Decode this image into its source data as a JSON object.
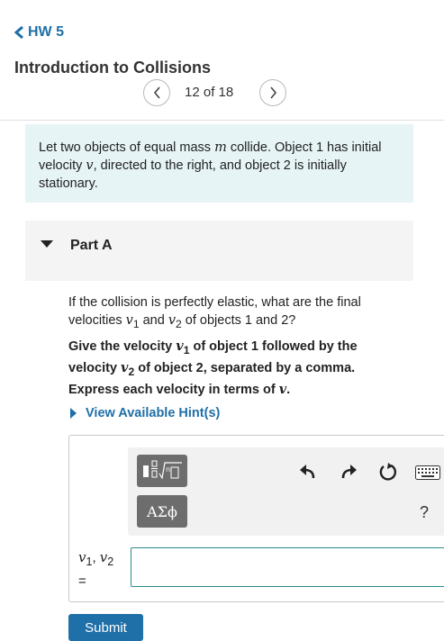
{
  "nav": {
    "back_label": "HW 5"
  },
  "header": {
    "title": "Introduction to Collisions",
    "counter": "12 of 18"
  },
  "intro": {
    "segments": [
      "Let two objects of equal mass ",
      "m",
      " collide. Object 1 has initial velocity ",
      "v",
      ", directed to the right, and object 2 is initially stationary."
    ]
  },
  "part": {
    "title": "Part A"
  },
  "question": {
    "segments": [
      "If the collision is perfectly elastic, what are the final velocities ",
      "v",
      "1",
      " and ",
      "v",
      "2",
      " of objects 1 and 2?"
    ]
  },
  "instructions": {
    "segments": [
      "Give the velocity ",
      "v",
      "1",
      " of object 1 followed by the velocity ",
      "v",
      "2",
      " of object 2, separated by a comma. Express each velocity in terms of ",
      "v",
      "."
    ]
  },
  "hint": {
    "label": "View Available Hint(s)"
  },
  "toolbar": {
    "symbol_label": "ΑΣϕ",
    "help_label": "?",
    "icons": [
      "templates-icon",
      "undo-icon",
      "redo-icon",
      "reset-icon",
      "keyboard-icon"
    ]
  },
  "answer": {
    "label_parts": [
      "v",
      "1",
      ", ",
      "v",
      "2",
      "="
    ],
    "value": ""
  },
  "submit": {
    "label": "Submit"
  },
  "colors": {
    "accent": "#1f6fa8",
    "intro_bg": "#e6f4f6",
    "input_border": "#2a8a8a",
    "tool_button": "#6d6d6d"
  }
}
